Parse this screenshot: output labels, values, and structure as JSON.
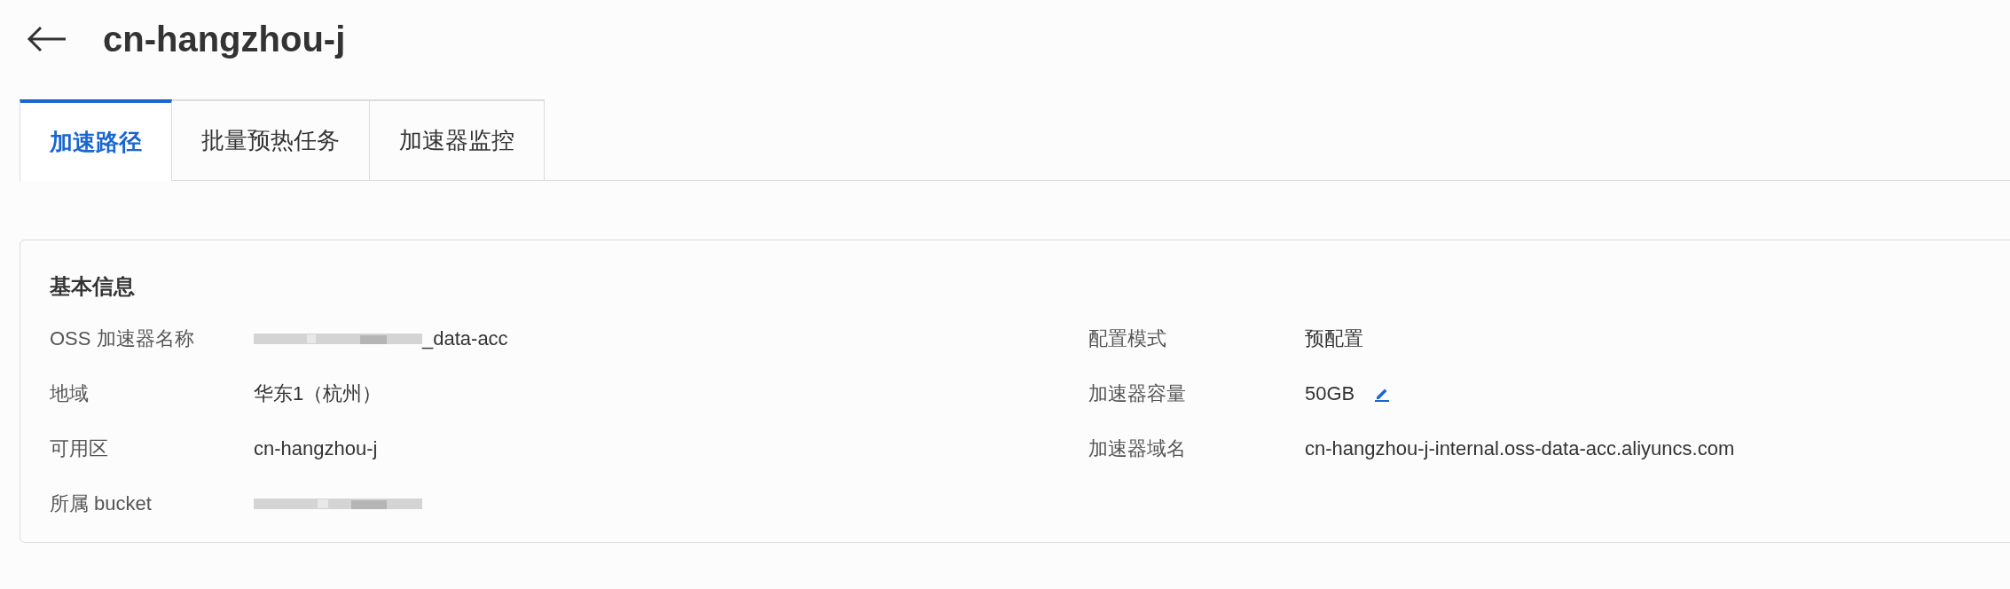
{
  "header": {
    "title": "cn-hangzhou-j"
  },
  "tabs": [
    {
      "label": "加速路径",
      "selected": true
    },
    {
      "label": "批量预热任务",
      "selected": false
    },
    {
      "label": "加速器监控",
      "selected": false
    }
  ],
  "panel": {
    "title": "基本信息",
    "fields": [
      {
        "label": "OSS 加速器名称",
        "kind": "redacted_suffix",
        "value": "_data-acc"
      },
      {
        "label": "配置模式",
        "kind": "text",
        "value": "预配置"
      },
      {
        "label": "地域",
        "kind": "text",
        "value": "华东1（杭州）"
      },
      {
        "label": "加速器容量",
        "kind": "editable",
        "value": "50GB"
      },
      {
        "label": "可用区",
        "kind": "text",
        "value": "cn-hangzhou-j"
      },
      {
        "label": "加速器域名",
        "kind": "text",
        "value": "cn-hangzhou-j-internal.oss-data-acc.aliyuncs.com"
      },
      {
        "label": "所属 bucket",
        "kind": "redacted"
      }
    ]
  }
}
